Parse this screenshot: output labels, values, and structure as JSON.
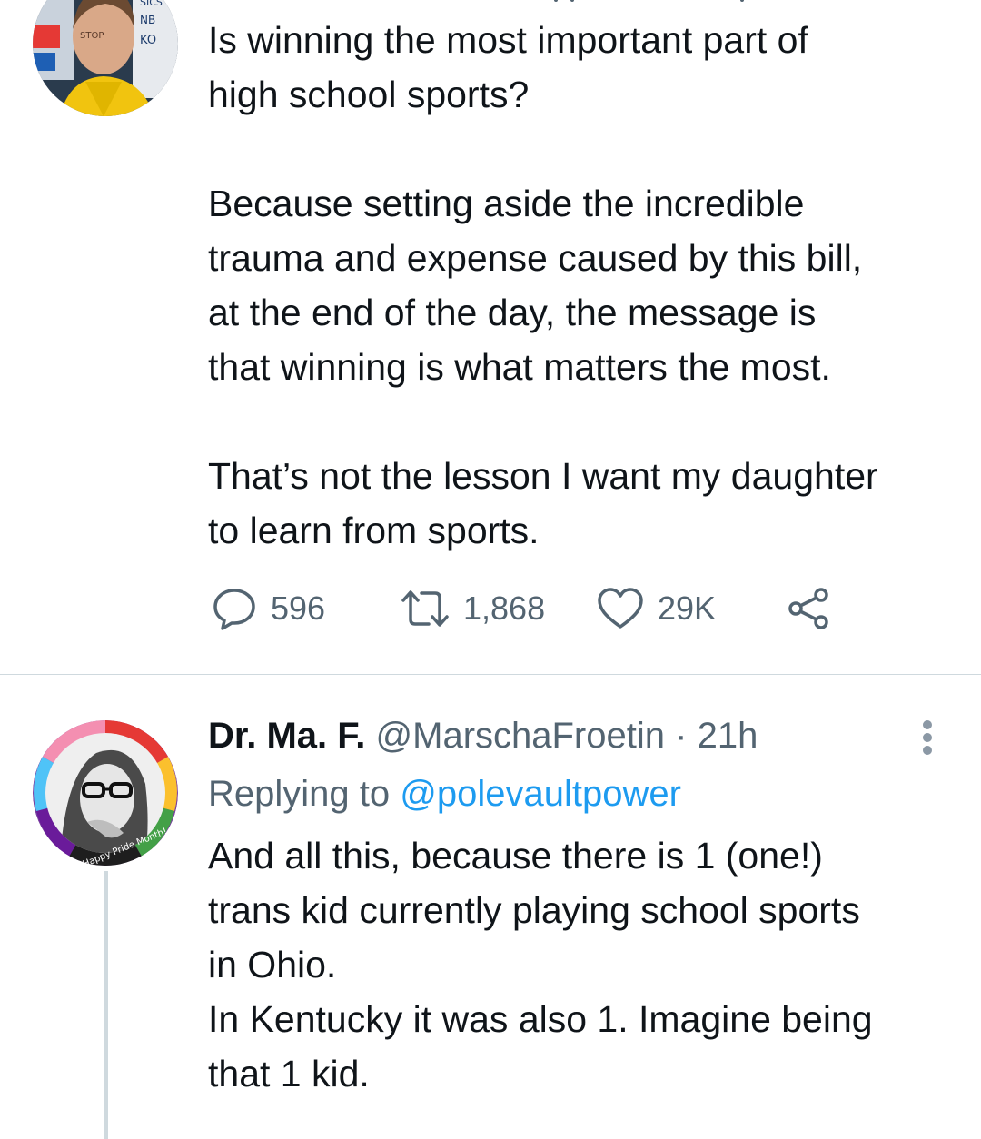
{
  "colors": {
    "text": "#0f1419",
    "secondary": "#536471",
    "link": "#1d9bf0",
    "divider": "#cfd9de"
  },
  "tweet1": {
    "body": "Is winning the most important part of\nhigh school sports?\n\nBecause setting aside the incredible\ntrauma and expense caused by this bill,\nat the end of the day, the message is\nthat winning is what matters the most.\n\nThat’s not the lesson I want my daughter\nto learn from sports.",
    "avatar_icon": "athlete-photo",
    "avatar_text": [
      "SICS",
      "NB",
      "KO",
      "STOP"
    ],
    "stats": {
      "replies": "596",
      "retweets": "1,868",
      "likes": "29K"
    },
    "icons": {
      "reply": "reply-icon",
      "retweet": "retweet-icon",
      "like": "heart-icon",
      "share": "share-icon"
    }
  },
  "tweet2": {
    "name": "Dr. Ma. F.",
    "handle": "@MarschaFroetin",
    "separator": "·",
    "time": "21h",
    "replying_prefix": "Replying to",
    "replying_to": "@polevaultpower",
    "body": "And all this, because there is 1 (one!)\ntrans kid currently playing school sports\nin Ohio.\nIn Kentucky it was also 1. Imagine being\nthat 1 kid.",
    "avatar_badge": "Happy Pride Month!",
    "more_icon": "more-options-icon"
  }
}
